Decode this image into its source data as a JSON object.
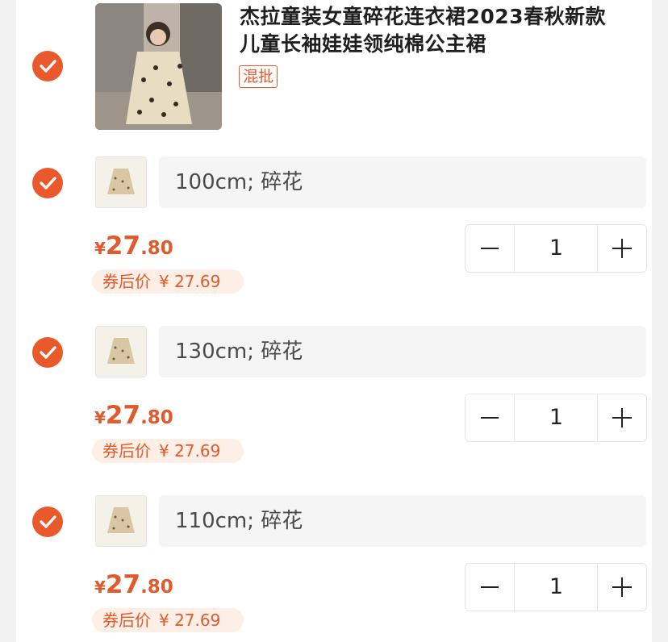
{
  "product": {
    "title_line1": "杰拉童装女童碎花连衣裙2023春秋新款",
    "title_line2": "儿童长袖娃娃领纯棉公主裙",
    "badge": "混批"
  },
  "variants": [
    {
      "spec": "100cm; 碎花",
      "price_symbol": "¥",
      "price_int": "27",
      "price_dec": ".80",
      "coupon_label": "券后价",
      "coupon_price": "¥ 27.69",
      "quantity": "1"
    },
    {
      "spec": "130cm; 碎花",
      "price_symbol": "¥",
      "price_int": "27",
      "price_dec": ".80",
      "coupon_label": "券后价",
      "coupon_price": "¥ 27.69",
      "quantity": "1"
    },
    {
      "spec": "110cm; 碎花",
      "price_symbol": "¥",
      "price_int": "27",
      "price_dec": ".80",
      "coupon_label": "券后价",
      "coupon_price": "¥ 27.69",
      "quantity": "1"
    }
  ],
  "colors": {
    "accent": "#e9592c",
    "price": "#e15a2c",
    "coupon_bg": "#fdeee6"
  },
  "icons": [
    "check-circle-icon",
    "minus-icon",
    "plus-icon"
  ]
}
